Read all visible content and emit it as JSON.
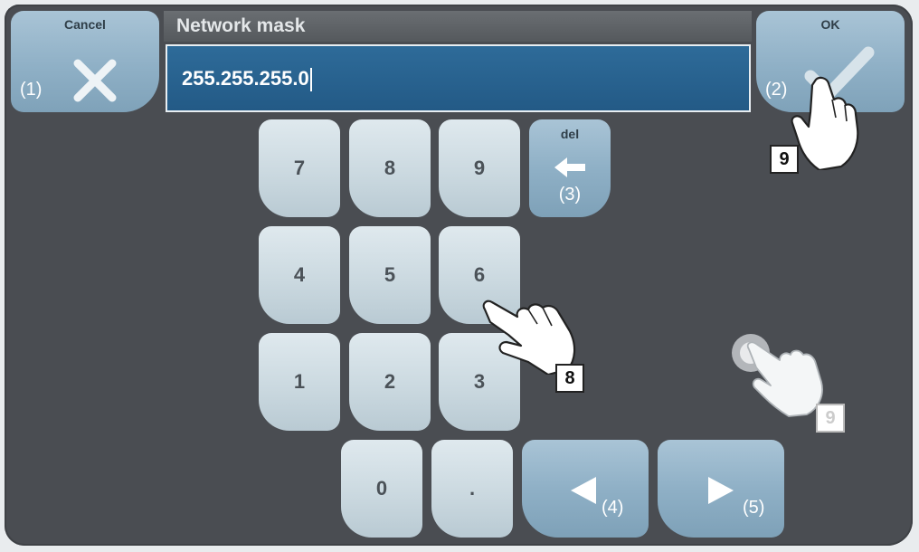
{
  "dialog": {
    "title": "Network mask",
    "input_value": "255.255.255.0"
  },
  "cancel_button": {
    "label": "Cancel",
    "callout": "(1)"
  },
  "ok_button": {
    "label": "OK",
    "callout": "(2)"
  },
  "keypad": {
    "keys": [
      "7",
      "8",
      "9",
      "4",
      "5",
      "6",
      "1",
      "2",
      "3",
      "0",
      "."
    ],
    "del_label": "del",
    "del_callout": "(3)",
    "left_callout": "(4)",
    "right_callout": "(5)"
  },
  "annotations": {
    "step_ok": "9",
    "step_key": "8",
    "step_tap": "9"
  },
  "colors": {
    "panel": "#4a4d52",
    "input_bg": "#2e6b99",
    "key_light": "#d3e0e6",
    "key_blue": "#8fb0c6"
  }
}
